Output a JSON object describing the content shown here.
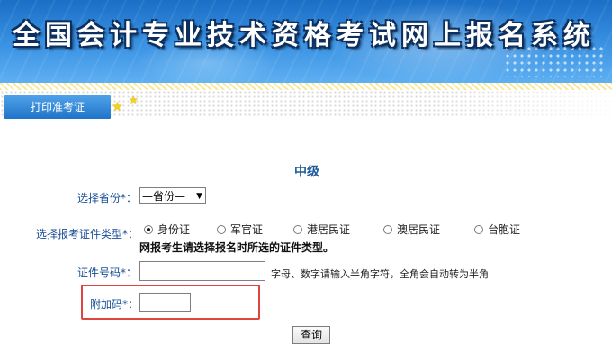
{
  "banner": {
    "title": "全国会计专业技术资格考试网上报名系统"
  },
  "tab": {
    "print_label": "打印准考证"
  },
  "level": "中级",
  "form": {
    "province": {
      "label": "选择省份",
      "required_mark": "*：",
      "selected": "—省份—"
    },
    "id_type": {
      "label": "选择报考证件类型",
      "required_mark": "*：",
      "options": [
        "身份证",
        "军官证",
        "港居民证",
        "澳居民证",
        "台胞证"
      ],
      "selected_index": 0,
      "note": "网报考生请选择报名时所选的证件类型。"
    },
    "id_number": {
      "label": "证件号码",
      "required_mark": "*：",
      "value": "",
      "hint": "字母、数字请输入半角字符，全角会自动转为半角"
    },
    "captcha": {
      "label": "附加码",
      "required_mark": "*：",
      "value": ""
    }
  },
  "query_button": "查询",
  "colors": {
    "label": "#1a4f96",
    "highlight": "#e0443f",
    "tab": "#2a80d2"
  }
}
